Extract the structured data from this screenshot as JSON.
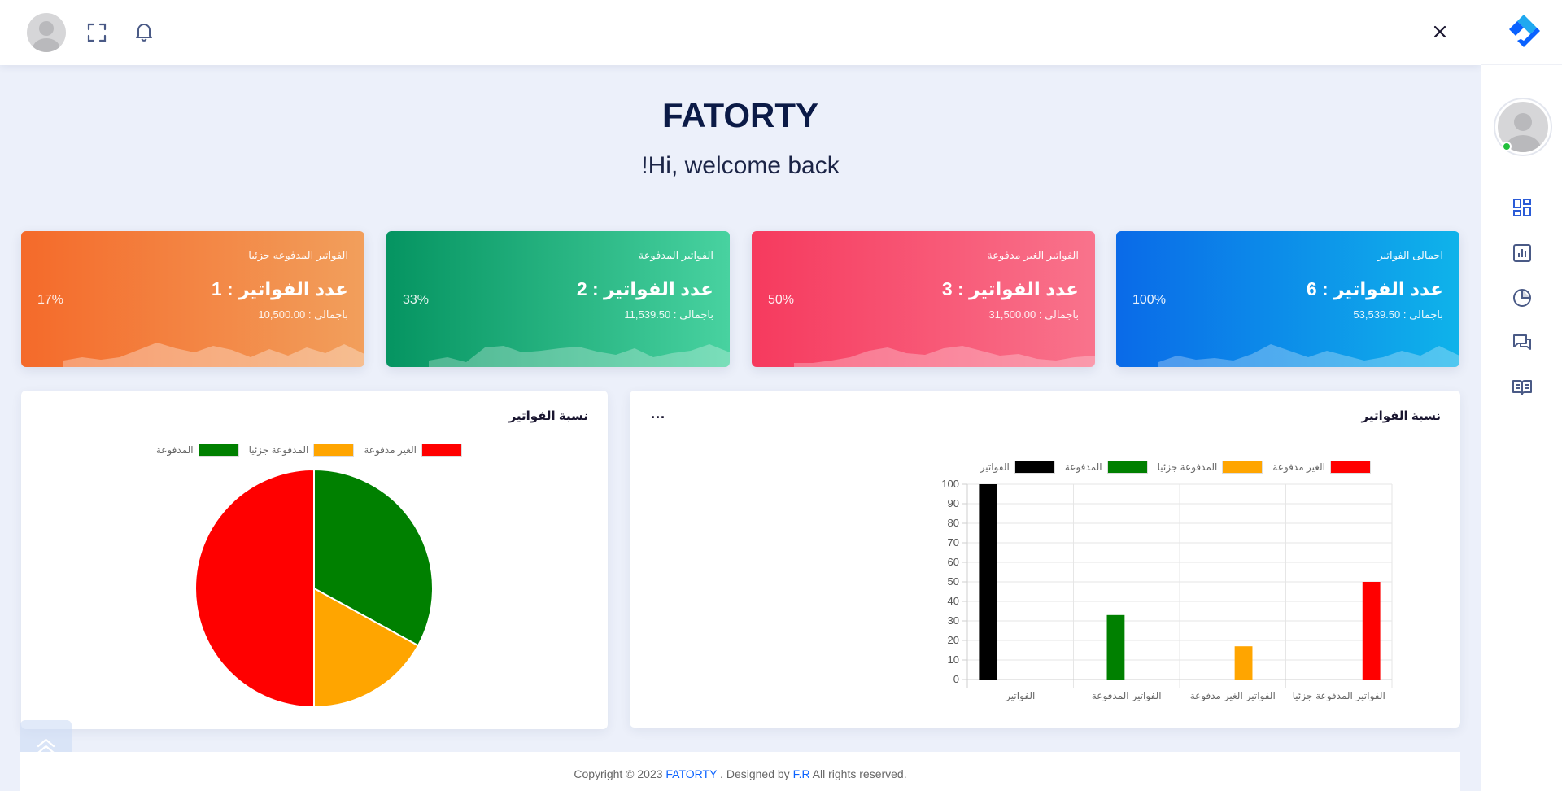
{
  "header": {
    "avatar_icon": "user-avatar",
    "fullscreen_icon": "fullscreen-icon",
    "bell_icon": "bell-icon",
    "close_icon": "close-icon"
  },
  "sidebar": {
    "logo_icon": "brand-logo",
    "nav": [
      {
        "icon": "dashboard-icon"
      },
      {
        "icon": "reports-icon"
      },
      {
        "icon": "pie-chart-icon"
      },
      {
        "icon": "chat-icon"
      },
      {
        "icon": "book-icon"
      }
    ],
    "accent_color": "#2a5bd7"
  },
  "heading": {
    "title": "FATORTY",
    "subtitle": "!Hi, welcome back"
  },
  "cards": [
    {
      "label": "اجمالى الفواتير",
      "count": "عدد الفواتير : 6",
      "total": "باجمالى : 53,539.50",
      "percent": "100%",
      "gradient": [
        "#0a6ae8",
        "#0fb3ea"
      ]
    },
    {
      "label": "الفواتير الغير مدفوعة",
      "count": "عدد الفواتير : 3",
      "total": "باجمالى : 31,500.00",
      "percent": "50%",
      "gradient": [
        "#f63a5e",
        "#f9738c"
      ]
    },
    {
      "label": "الفواتير المدفوعة",
      "count": "عدد الفواتير : 2",
      "total": "باجمالى : 11,539.50",
      "percent": "33%",
      "gradient": [
        "#059461",
        "#48d2a0"
      ]
    },
    {
      "label": "الفواتير المدفوعه جزئيا",
      "count": "عدد الفواتير : 1",
      "total": "باجمالى : 10,500.00",
      "percent": "17%",
      "gradient": [
        "#f46a2a",
        "#f29f5c"
      ]
    }
  ],
  "bar_panel": {
    "title": "نسبة الفواتير",
    "menu": "...",
    "chart_data": {
      "type": "bar",
      "categories": [
        "الفواتير",
        "الفواتير المدفوعة",
        "الفواتير الغير مدفوعة",
        "الفواتير المدفوعة جزئيا"
      ],
      "series": [
        {
          "name": "الفواتير",
          "color": "#000000",
          "values": [
            100,
            0,
            0,
            0
          ]
        },
        {
          "name": "المدفوعة",
          "color": "#008000",
          "values": [
            0,
            33,
            0,
            0
          ]
        },
        {
          "name": "المدفوعة جزئيا",
          "color": "#ffa500",
          "values": [
            0,
            0,
            17,
            0
          ]
        },
        {
          "name": "الغير مدفوعة",
          "color": "#ff0000",
          "values": [
            0,
            0,
            0,
            50
          ]
        }
      ],
      "ylim": [
        0,
        100
      ],
      "yticks": [
        "0",
        "10",
        "20",
        "30",
        "40",
        "50",
        "60",
        "70",
        "80",
        "90",
        "100"
      ],
      "grid": true,
      "legend": "top"
    }
  },
  "pie_panel": {
    "title": "نسبة الفواتير",
    "chart_data": {
      "type": "pie",
      "labels": [
        "الغير مدفوعة",
        "المدفوعة جزئيا",
        "المدفوعة"
      ],
      "values": [
        50,
        17,
        33
      ],
      "colors": [
        "#ff0000",
        "#ffa500",
        "#008000"
      ],
      "legend": "top"
    }
  },
  "footer": {
    "pre": "Copyright © 2023 ",
    "brand": "FATORTY",
    "mid": " . Designed by ",
    "designer": "F.R",
    "post": " All rights reserved."
  }
}
